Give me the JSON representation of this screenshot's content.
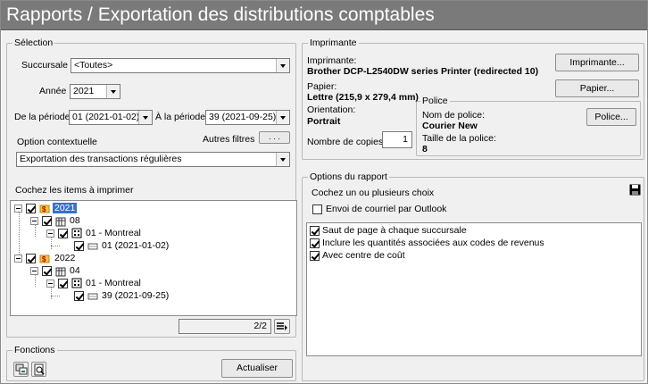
{
  "window": {
    "title": "Rapports / Exportation des distributions comptables"
  },
  "selection": {
    "legend": "Sélection",
    "branch_label": "Succursale",
    "branch_value": "<Toutes>",
    "year_label": "Année",
    "year_value": "2021",
    "from_period_label": "De la période",
    "from_period_value": "01 (2021-01-02)",
    "to_period_label": "À la période",
    "to_period_value": "39 (2021-09-25)",
    "context_option_label": "Option contextuelle",
    "other_filters_label": "Autres filtres",
    "other_filters_button": ". . .",
    "context_option_value": "Exportation des transactions régulières",
    "tree_label": "Cochez les items à imprimer",
    "tree": [
      {
        "label": "2021",
        "level": 0,
        "kind": "year",
        "selected": true
      },
      {
        "label": "08",
        "level": 1,
        "kind": "period"
      },
      {
        "label": "01 - Montreal",
        "level": 2,
        "kind": "branch"
      },
      {
        "label": "01 (2021-01-02)",
        "level": 3,
        "kind": "item"
      },
      {
        "label": "2022",
        "level": 0,
        "kind": "year"
      },
      {
        "label": "04",
        "level": 1,
        "kind": "period"
      },
      {
        "label": "01 - Montreal",
        "level": 2,
        "kind": "branch"
      },
      {
        "label": "39 (2021-09-25)",
        "level": 3,
        "kind": "item"
      }
    ],
    "page_count": "2/2"
  },
  "functions": {
    "legend": "Fonctions",
    "refresh_button": "Actualiser"
  },
  "printer": {
    "legend": "Imprimante",
    "printer_label": "Imprimante:",
    "printer_value": "Brother DCP-L2540DW series Printer (redirected 10)",
    "printer_button": "Imprimante...",
    "paper_label": "Papier:",
    "paper_value": "Lettre (215,9 x 279,4 mm)",
    "paper_button": "Papier...",
    "orientation_label": "Orientation:",
    "orientation_value": "Portrait",
    "copies_label": "Nombre de copies:",
    "copies_value": "1",
    "font": {
      "legend": "Police",
      "name_label": "Nom de police:",
      "name_value": "Courier New",
      "size_label": "Taille de la police:",
      "size_value": "8",
      "button": "Police..."
    }
  },
  "report_options": {
    "legend": "Options du rapport",
    "instruction": "Cochez un ou plusieurs choix",
    "outlook_label": "Envoi de courriel par Outlook",
    "outlook_checked": false,
    "options": [
      {
        "label": "Saut de page à chaque succursale",
        "checked": true
      },
      {
        "label": "Inclure les quantités associées aux codes de revenus",
        "checked": true
      },
      {
        "label": "Avec centre de coût",
        "checked": true
      }
    ]
  }
}
